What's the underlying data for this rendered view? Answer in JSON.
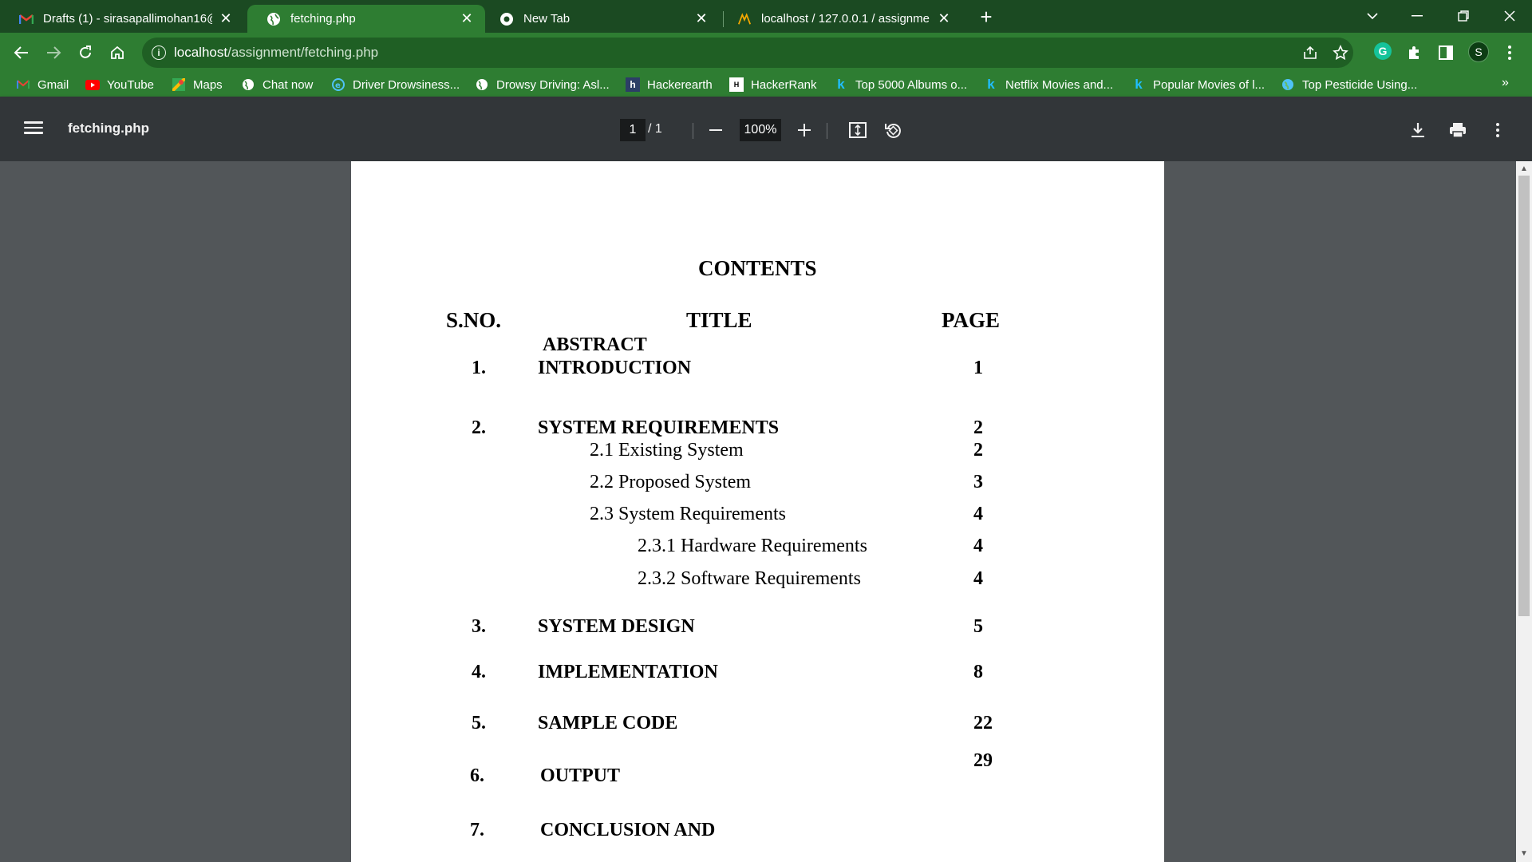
{
  "browser": {
    "tabs": [
      {
        "title": "Drafts (1) - sirasapallimohan16@"
      },
      {
        "title": "fetching.php"
      },
      {
        "title": "New Tab"
      },
      {
        "title": "localhost / 127.0.0.1 / assignmen"
      }
    ],
    "url": {
      "host": "localhost",
      "path": "/assignment/fetching.php"
    },
    "accent": "#2e7d32"
  },
  "bookmarks": [
    {
      "label": "Gmail"
    },
    {
      "label": "YouTube"
    },
    {
      "label": "Maps"
    },
    {
      "label": "Chat now"
    },
    {
      "label": "Driver Drowsiness..."
    },
    {
      "label": "Drowsy Driving: Asl..."
    },
    {
      "label": "Hackerearth"
    },
    {
      "label": "HackerRank"
    },
    {
      "label": "Top 5000 Albums o..."
    },
    {
      "label": "Netflix Movies and..."
    },
    {
      "label": "Popular Movies of l..."
    },
    {
      "label": "Top Pesticide Using..."
    }
  ],
  "profile": {
    "initial": "S"
  },
  "pdf": {
    "filename": "fetching.php",
    "current_page": "1",
    "total_pages": "/  1",
    "zoom": "100%"
  },
  "doc": {
    "heading": "CONTENTS",
    "col_sno": "S.NO.",
    "col_title": "TITLE",
    "col_page": "PAGE",
    "abstract": "ABSTRACT",
    "rows": [
      {
        "sno": "1.",
        "title": "INTRODUCTION",
        "page": "1"
      },
      {
        "sno": "2.",
        "title": "SYSTEM REQUIREMENTS",
        "page": "2"
      },
      {
        "title": "2.1 Existing System",
        "page": "2"
      },
      {
        "title": "2.2 Proposed System",
        "page": "3"
      },
      {
        "title": "2.3 System Requirements",
        "page": "4"
      },
      {
        "title": "2.3.1 Hardware Requirements",
        "page": "4"
      },
      {
        "title": "2.3.2 Software Requirements",
        "page": "4"
      },
      {
        "sno": "3.",
        "title": "SYSTEM DESIGN",
        "page": "5"
      },
      {
        "sno": "4.",
        "title": "IMPLEMENTATION",
        "page": "8"
      },
      {
        "sno": "5.",
        "title": "SAMPLE CODE",
        "page": "22"
      },
      {
        "sno": "6.",
        "title": "OUTPUT",
        "page": "29"
      },
      {
        "sno": "7.",
        "title": "CONCLUSION AND"
      }
    ]
  }
}
